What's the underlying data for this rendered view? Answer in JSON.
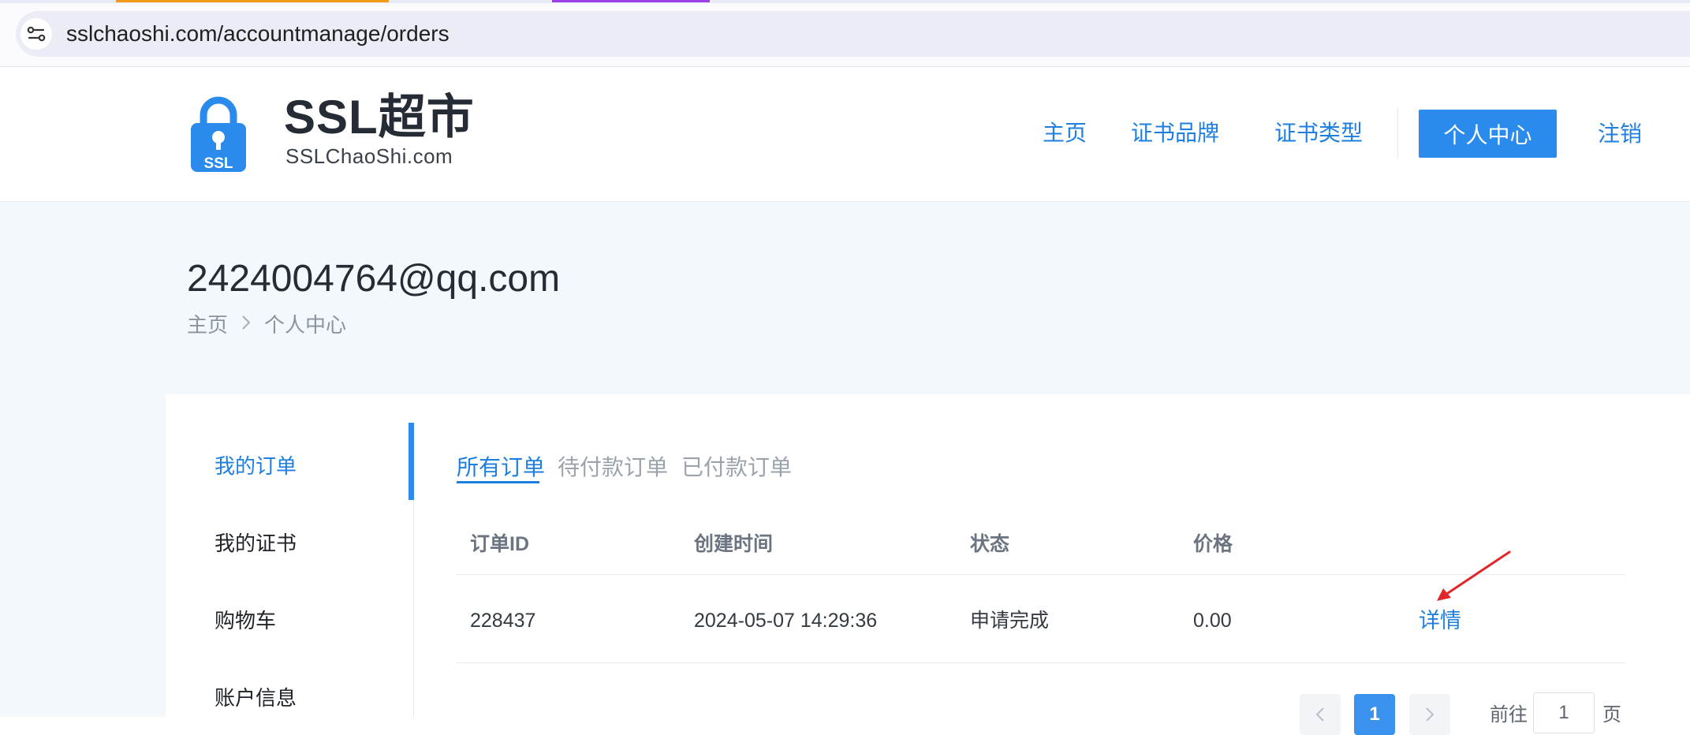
{
  "browser": {
    "url": "sslchaoshi.com/accountmanage/orders",
    "site_info_icon": "tune-icon"
  },
  "header": {
    "logo_icon": "padlock-icon",
    "logo_lock_text": "SSL",
    "brand_name": "SSL超市",
    "brand_domain": "SSLChaoShi.com",
    "nav": {
      "home": "主页",
      "brands": "证书品牌",
      "types": "证书类型",
      "account": "个人中心",
      "logout": "注销"
    },
    "accent_color": "#2a8bec"
  },
  "hero": {
    "user_email": "2424004764@qq.com",
    "breadcrumb": [
      "主页",
      "个人中心"
    ],
    "breadcrumb_separator_icon": "chevron-right-icon"
  },
  "sidebar": {
    "items": [
      {
        "label": "我的订单",
        "active": true
      },
      {
        "label": "我的证书",
        "active": false
      },
      {
        "label": "购物车",
        "active": false
      },
      {
        "label": "账户信息",
        "active": false
      }
    ]
  },
  "orders": {
    "tabs": [
      {
        "label": "所有订单",
        "active": true
      },
      {
        "label": "待付款订单",
        "active": false
      },
      {
        "label": "已付款订单",
        "active": false
      }
    ],
    "columns": [
      "订单ID",
      "创建时间",
      "状态",
      "价格"
    ],
    "rows": [
      {
        "id": "228437",
        "created": "2024-05-07 14:29:36",
        "status": "申请完成",
        "price": "0.00",
        "action": "详情"
      }
    ],
    "annotation_arrow_color": "#e0262a"
  },
  "pagination": {
    "prev_icon": "chevron-left-icon",
    "next_icon": "chevron-right-icon",
    "current_page": "1",
    "goto_prefix": "前往",
    "goto_value": "1",
    "goto_suffix": "页"
  }
}
